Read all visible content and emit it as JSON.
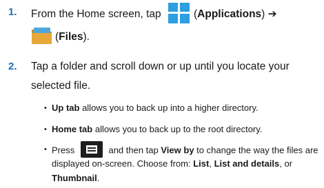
{
  "step1": {
    "number": "1.",
    "before_apps": "From the Home screen, tap",
    "apps_label": "Applications",
    "files_label": "Files"
  },
  "step2": {
    "number": "2.",
    "line1": "Tap a folder and scroll down or up until you locate your",
    "line2": "selected file."
  },
  "bullets": [
    {
      "term": "Up tab",
      "text": " allows you to back up into a higher directory."
    },
    {
      "term": "Home tab",
      "text": " allows you to back up to the root directory."
    }
  ],
  "bullet3": {
    "press": "Press",
    "then_tap": " and then tap ",
    "view_by": "View by",
    "rest1": " to change the way the files are",
    "line2": "displayed on-screen. Choose from: ",
    "opt_list": "List",
    "sep1": ", ",
    "opt_list_details": "List and details",
    "sep2": ", or",
    "opt_thumbnail": "Thumbnail",
    "end": "."
  },
  "colors": {
    "number": "#1a6fb7",
    "apps_icon": "#2d9ee0",
    "folder": "#e7a83a"
  },
  "icons": {
    "apps": "apps-grid-icon",
    "files": "folder-icon",
    "menu": "menu-key-icon"
  }
}
